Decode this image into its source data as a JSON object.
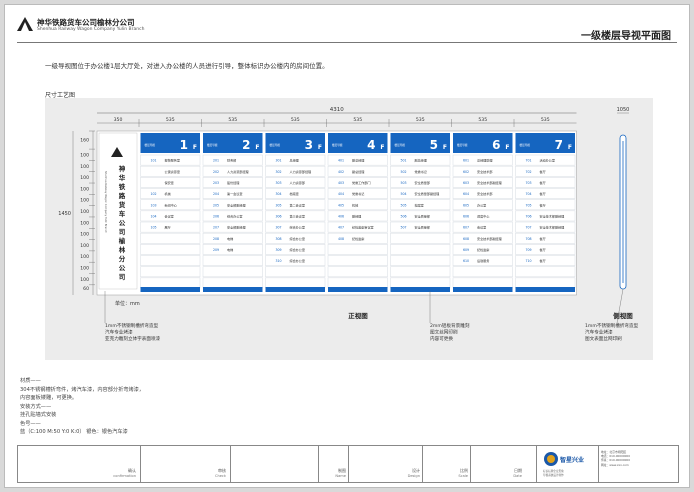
{
  "header": {
    "company_name": "神华铁路货车公司榆林分公司",
    "company_en": "Shenhua Railway Wagon Company Yulin Branch",
    "drawing_title": "一级楼层导视平面图"
  },
  "description": "一级导视图位于办公楼1层大厅处，对进入办公楼的人员进行引导，整体标识办公楼内的房间位置。",
  "size_label": "尺寸工艺图",
  "dimensions": {
    "total_width": "4310",
    "side_width": "1050",
    "height_total": "1450",
    "first_col": "350",
    "floor_width": "535",
    "row_heights": [
      "160",
      "100",
      "100",
      "100",
      "100",
      "100",
      "100",
      "100",
      "100",
      "100",
      "100",
      "100",
      "100",
      "60"
    ],
    "unit": "单位：mm"
  },
  "front_sign": {
    "company_vertical": "神华铁路货车公司榆林分公司",
    "company_vertical_en": "Shenhua Railway Wagon Company Yulin Branch",
    "floors": [
      {
        "label": "1",
        "rooms": [
          [
            "101",
            "报警服务室"
          ],
          [
            "",
            "公寓资源室"
          ],
          [
            "",
            "保安室"
          ],
          [
            "102",
            "机械"
          ],
          [
            "103",
            "新闻中心"
          ],
          [
            "104",
            "会议室"
          ],
          [
            "105",
            "展厅"
          ]
        ]
      },
      {
        "label": "2",
        "rooms": [
          [
            "201",
            "财务部"
          ],
          [
            "202",
            "人力资源部经理"
          ],
          [
            "203",
            "股份经理"
          ],
          [
            "204",
            "第一会议室"
          ],
          [
            "205",
            "安全部副经理"
          ],
          [
            "206",
            "综合办公室"
          ],
          [
            "207",
            "安全部副经理"
          ],
          [
            "208",
            "电梯"
          ],
          [
            "209",
            "电梯"
          ]
        ]
      },
      {
        "label": "3",
        "rooms": [
          [
            "301",
            "总经理"
          ],
          [
            "302",
            "人力资源部经理"
          ],
          [
            "303",
            "人力资源部"
          ],
          [
            "304",
            "档案室"
          ],
          [
            "305",
            "第二会议室"
          ],
          [
            "306",
            "第三会议室"
          ],
          [
            "307",
            "综合办公室"
          ],
          [
            "308",
            "综合办公室"
          ],
          [
            "309",
            "综合办公室"
          ],
          [
            "310",
            "综合办公室"
          ]
        ]
      },
      {
        "label": "4",
        "rooms": [
          [
            "401",
            "副总经理"
          ],
          [
            "402",
            "副总经理"
          ],
          [
            "403",
            "党委工作部门"
          ],
          [
            "404",
            "党委书记"
          ],
          [
            "405",
            "机械"
          ],
          [
            "406",
            "副经理"
          ],
          [
            "407",
            "纪检监察审议室"
          ],
          [
            "408",
            "纪检监察"
          ]
        ]
      },
      {
        "label": "5",
        "rooms": [
          [
            "501",
            "副总经理"
          ],
          [
            "502",
            "党委书记"
          ],
          [
            "503",
            "安全质量部"
          ],
          [
            "504",
            "安全质量部副经理"
          ],
          [
            "505",
            "档案室"
          ],
          [
            "506",
            "安全质量部"
          ],
          [
            "507",
            "安全质量部"
          ]
        ]
      },
      {
        "label": "6",
        "rooms": [
          [
            "601",
            "总经理助理"
          ],
          [
            "602",
            "安全技术部"
          ],
          [
            "603",
            "安全技术部副经理"
          ],
          [
            "604",
            "安全技术部"
          ],
          [
            "605",
            "办公室"
          ],
          [
            "606",
            "调度中心"
          ],
          [
            "607",
            "会议室"
          ],
          [
            "608",
            "安全技术部副经理"
          ],
          [
            "609",
            "纪检监察"
          ],
          [
            "610",
            "后勤服务"
          ]
        ]
      },
      {
        "label": "7",
        "rooms": [
          [
            "701",
            "活动办公室"
          ],
          [
            "702",
            "餐厅"
          ],
          [
            "703",
            "餐厅"
          ],
          [
            "704",
            "餐厅"
          ],
          [
            "705",
            "餐厅"
          ],
          [
            "706",
            "安全技术部副经理"
          ],
          [
            "707",
            "安全技术部副经理"
          ],
          [
            "708",
            "餐厅"
          ],
          [
            "709",
            "餐厅"
          ],
          [
            "710",
            "餐厅"
          ]
        ]
      }
    ]
  },
  "annotations": {
    "left": [
      "1mm不锈钢制槽折弯造型",
      "汽车专业烤漆",
      "亚克力雕刻立体字表面喷漆"
    ],
    "middle": [
      "2mm铝板背景雕刻",
      "图文丝网印刷",
      "内容可更换"
    ],
    "right": [
      "1mm不锈钢制槽折弯造型",
      "汽车专业烤漆",
      "图文表面丝网印刷"
    ],
    "front_view": "正视图",
    "side_view": "侧视图"
  },
  "notes": [
    "材质——",
    "304不锈钢槽折弯件，烤汽车漆，内容部分折弯烤漆，",
    "内容面板镂雕，可更换。",
    "安装方式——",
    "挂孔贴墙式安装",
    "色号——",
    "蓝（C:100 M:50 Y:0 K:0） 银色：银色汽车漆"
  ],
  "footer": {
    "fields": [
      {
        "label": "确认",
        "sub": "confirmation"
      },
      {
        "label": "审核",
        "sub": "Check"
      },
      {
        "label": "制图",
        "sub": "Name"
      },
      {
        "label": "设计",
        "sub": "Design"
      },
      {
        "label": "比例",
        "sub": "Scale"
      },
      {
        "label": "日期",
        "sub": "Date"
      }
    ],
    "brand_name": "智星兴业",
    "brand_small": [
      "标识标牌企业形象",
      "导视系统设计制作"
    ],
    "contact": [
      "地址：北京市朝阳区",
      "电话：010-00000000",
      "传真：010-00000000",
      "网址：www.xxx.com"
    ]
  },
  "colors": {
    "blue": "#1565c0",
    "panel": "#ececec",
    "sign_bg": "#ffffff",
    "row_line": "#d6dbe2"
  }
}
